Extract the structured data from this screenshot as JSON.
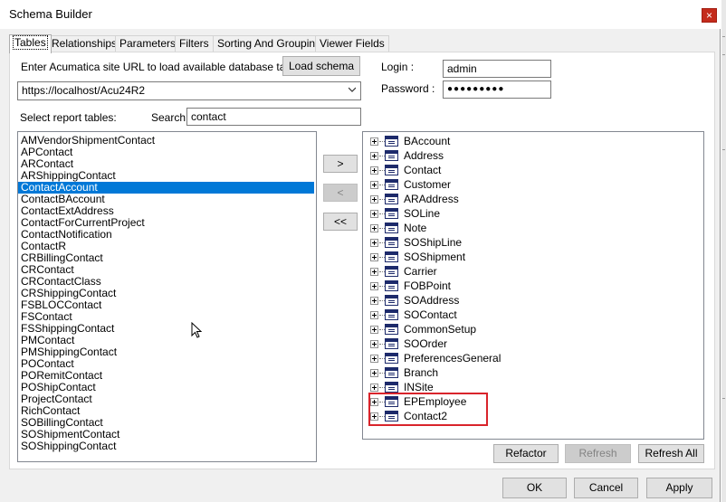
{
  "window": {
    "title": "Schema Builder",
    "close_glyph": "×"
  },
  "tabs": [
    {
      "label": "Tables",
      "active": true
    },
    {
      "label": "Relationships"
    },
    {
      "label": "Parameters"
    },
    {
      "label": "Filters"
    },
    {
      "label": "Sorting And Grouping"
    },
    {
      "label": "Viewer Fields"
    }
  ],
  "connection": {
    "url_prompt": "Enter Acumatica site URL to load available database tables:",
    "load_schema_label": "Load schema",
    "site_url": "https://localhost/Acu24R2",
    "login_label": "Login :",
    "login_value": "admin",
    "password_label": "Password :",
    "password_mask": "●●●●●●●●●"
  },
  "report_tables": {
    "select_label": "Select report tables:",
    "search_label": "Search:",
    "search_value": "contact",
    "items": [
      "AMVendorShipmentContact",
      "APContact",
      "ARContact",
      "ARShippingContact",
      "ContactAccount",
      "ContactBAccount",
      "ContactExtAddress",
      "ContactForCurrentProject",
      "ContactNotification",
      "ContactR",
      "CRBillingContact",
      "CRContact",
      "CRContactClass",
      "CRShippingContact",
      "FSBLOCContact",
      "FSContact",
      "FSShippingContact",
      "PMContact",
      "PMShippingContact",
      "POContact",
      "PORemitContact",
      "POShipContact",
      "ProjectContact",
      "RichContact",
      "SOBillingContact",
      "SOShipmentContact",
      "SOShippingContact"
    ],
    "selected_item": "ContactAccount"
  },
  "transfer": {
    "add_label": ">",
    "remove_label": "<",
    "remove_all_label": "<<"
  },
  "schema_tree": {
    "items": [
      "BAccount",
      "Address",
      "Contact",
      "Customer",
      "ARAddress",
      "SOLine",
      "Note",
      "SOShipLine",
      "SOShipment",
      "Carrier",
      "FOBPoint",
      "SOAddress",
      "SOContact",
      "CommonSetup",
      "SOOrder",
      "PreferencesGeneral",
      "Branch",
      "INSite",
      "EPEmployee",
      "Contact2"
    ],
    "highlighted_items": [
      "EPEmployee",
      "Contact2"
    ],
    "highlight_color": "#d9242b"
  },
  "tree_buttons": {
    "refactor_label": "Refactor",
    "refresh_label": "Refresh",
    "refresh_all_label": "Refresh All"
  },
  "dialog_buttons": {
    "ok_label": "OK",
    "cancel_label": "Cancel",
    "apply_label": "Apply"
  },
  "colors": {
    "selection": "#0078d7",
    "table_icon": "#1d2a6b",
    "close_button": "#c42b1c"
  }
}
